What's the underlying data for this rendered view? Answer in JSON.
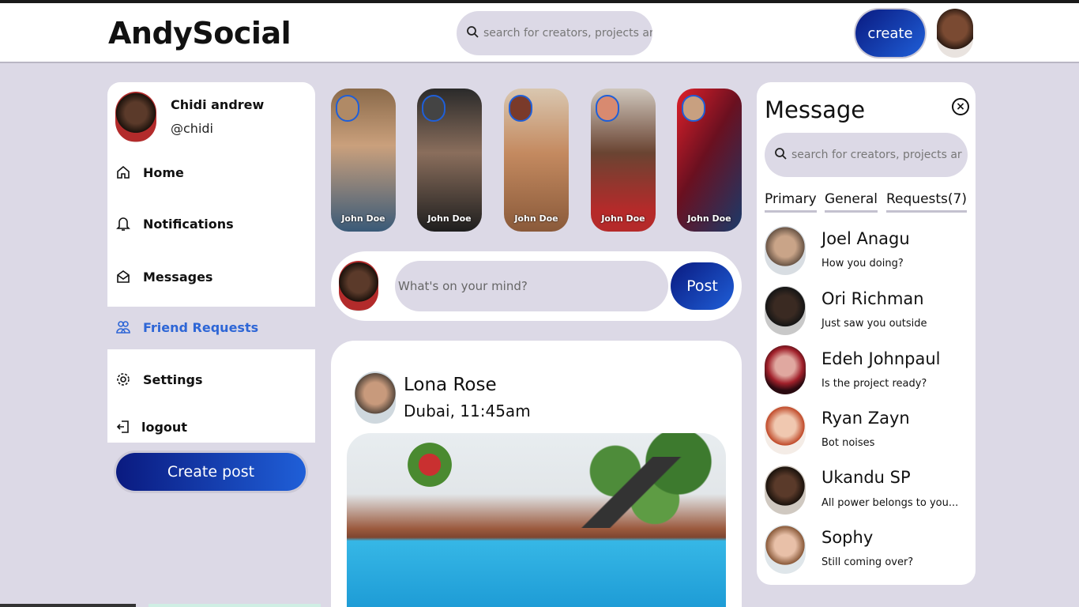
{
  "header": {
    "logo": "AndySocial",
    "search_placeholder": "search for creators, projects ar",
    "create_label": "create"
  },
  "profile": {
    "name": "Chidi andrew",
    "handle": "@chidi"
  },
  "sidebar": {
    "items": [
      {
        "label": "Home",
        "icon": "home-icon"
      },
      {
        "label": "Notifications",
        "icon": "bell-icon"
      },
      {
        "label": "Messages",
        "icon": "mail-icon"
      },
      {
        "label": "Friend Requests",
        "icon": "users-icon",
        "active": true
      },
      {
        "label": "Settings",
        "icon": "gear-icon"
      },
      {
        "label": "logout",
        "icon": "logout-icon"
      }
    ],
    "create_post_label": "Create post"
  },
  "stories": [
    {
      "name": "John Doe"
    },
    {
      "name": "John Doe"
    },
    {
      "name": "John Doe"
    },
    {
      "name": "John Doe"
    },
    {
      "name": "John Doe"
    }
  ],
  "composer": {
    "placeholder": "What's on your mind?",
    "post_label": "Post"
  },
  "feed": {
    "author": "Lona Rose",
    "location": "Dubai, 11:45am"
  },
  "messages": {
    "title": "Message",
    "search_placeholder": "search for creators, projects ar",
    "tabs": [
      "Primary",
      "General",
      "Requests(7)"
    ],
    "contacts": [
      {
        "name": "Joel Anagu",
        "preview": "How you doing?"
      },
      {
        "name": "Ori Richman",
        "preview": "Just saw you outside"
      },
      {
        "name": "Edeh Johnpaul",
        "preview": "Is the project ready?"
      },
      {
        "name": "Ryan Zayn",
        "preview": "Bot noises"
      },
      {
        "name": "Ukandu SP",
        "preview": "All power belongs to you..."
      },
      {
        "name": "Sophy",
        "preview": "Still coming over?"
      }
    ]
  },
  "colors": {
    "accent": "#2e66d6",
    "button_dark": "#0a1a80",
    "page_bg": "#dcd9e6"
  }
}
